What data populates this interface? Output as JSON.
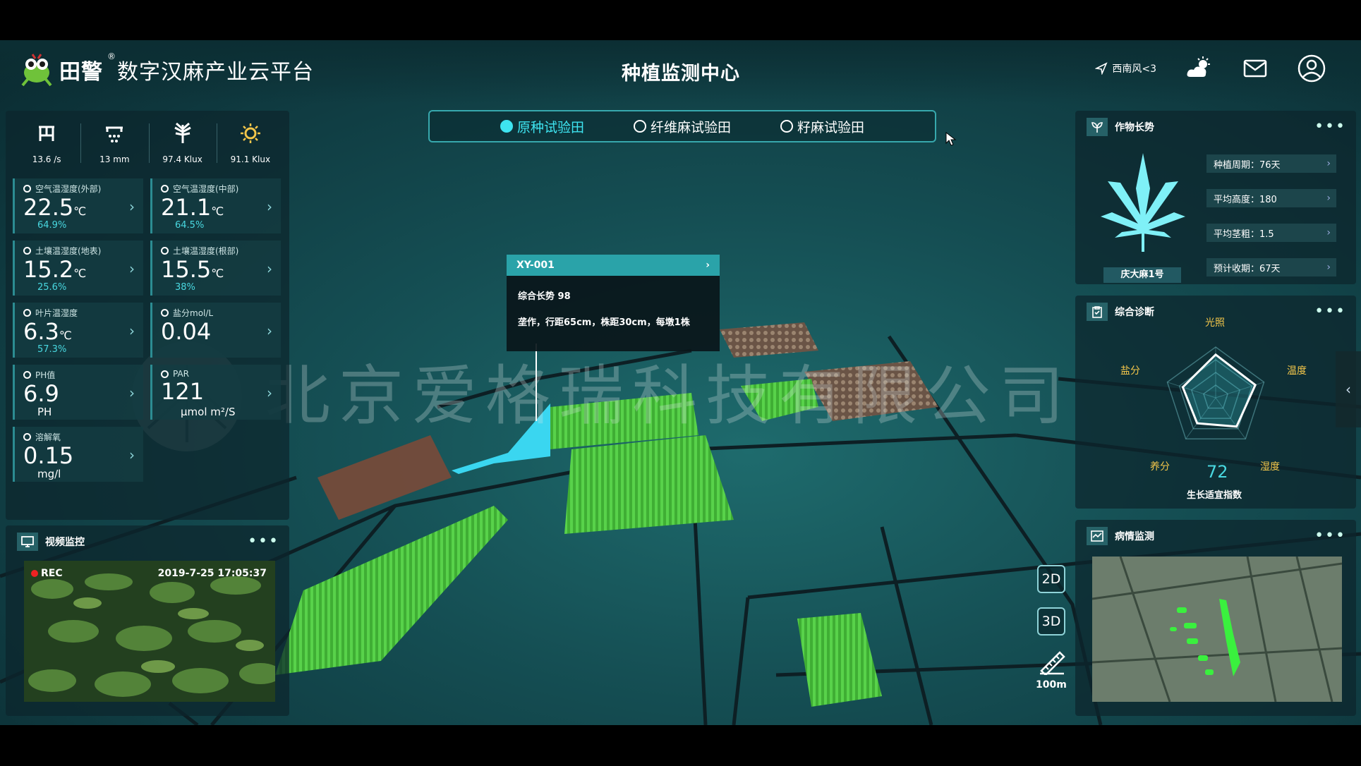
{
  "header": {
    "logo_text": "田警",
    "logo_reg": "®",
    "platform_name": "数字汉麻产业云平台",
    "center_title": "种植监测中心",
    "wind_label": "西南风<3",
    "icons": [
      "navigation-arrow-icon",
      "weather-cloud-sun-icon",
      "mail-icon",
      "user-icon"
    ]
  },
  "tabs": [
    {
      "label": "原种试验田",
      "active": true
    },
    {
      "label": "纤维麻试验田",
      "active": false
    },
    {
      "label": "籽麻试验田",
      "active": false
    }
  ],
  "weather": [
    {
      "icon": "wind-icon",
      "value": "13.6 /s"
    },
    {
      "icon": "rain-icon",
      "value": "13 mm"
    },
    {
      "icon": "leaf-light-icon",
      "value": "97.4 Klux"
    },
    {
      "icon": "sun-icon",
      "value": "91.1 Klux"
    }
  ],
  "sensors": [
    {
      "label": "空气温湿度(外部)",
      "value": "22.5",
      "unit": "℃",
      "sub": "64.9",
      "sub_unit": "%"
    },
    {
      "label": "空气温湿度(中部)",
      "value": "21.1",
      "unit": "℃",
      "sub": "64.5",
      "sub_unit": "%"
    },
    {
      "label": "土壤温湿度(地表)",
      "value": "15.2",
      "unit": "℃",
      "sub": "25.6",
      "sub_unit": "%"
    },
    {
      "label": "土壤温湿度(根部)",
      "value": "15.5",
      "unit": "℃",
      "sub": "38",
      "sub_unit": "%"
    },
    {
      "label": "叶片温湿度",
      "value": "6.3",
      "unit": "℃",
      "sub": "57.3",
      "sub_unit": "%"
    },
    {
      "label": "盐分mol/L",
      "value": "0.04",
      "unit": "",
      "sub": "",
      "sub_unit": ""
    },
    {
      "label": "PH值",
      "value": "6.9",
      "unit": "",
      "sub": "PH",
      "sub_unit": ""
    },
    {
      "label": "PAR",
      "value": "121",
      "unit": "",
      "sub": "μmol m²/S",
      "sub_unit": ""
    },
    {
      "label": "溶解氧",
      "value": "0.15",
      "unit": "",
      "sub": "mg/l",
      "sub_unit": ""
    }
  ],
  "video": {
    "title": "视频监控",
    "rec": "REC",
    "timestamp": "2019-7-25 17:05:37"
  },
  "growth": {
    "title": "作物长势",
    "variety": "庆大麻1号",
    "stats": [
      "种植周期：76天",
      "平均高度：180",
      "平均茎粗：1.5",
      "预计收期：67天"
    ]
  },
  "diagnosis": {
    "title": "综合诊断",
    "axes": [
      "光照",
      "温度",
      "湿度",
      "养分",
      "盐分"
    ],
    "values": [
      0.85,
      0.82,
      0.7,
      0.62,
      0.68
    ],
    "score": "72",
    "caption": "生长适宜指数"
  },
  "disease": {
    "title": "病情监测"
  },
  "tooltip": {
    "id": "XY-001",
    "line1": "综合长势 98",
    "line2": "垄作，行距65cm，株距30cm，每墩1株"
  },
  "map_controls": {
    "btn_2d": "2D",
    "btn_3d": "3D",
    "scale": "100m"
  },
  "watermark": "北京爱格瑞科技有限公司",
  "colors": {
    "accent": "#3ee4f0",
    "field_green": "#4fd03e",
    "panel_bg": "#0c262c",
    "radar_label": "#f3c64a"
  }
}
